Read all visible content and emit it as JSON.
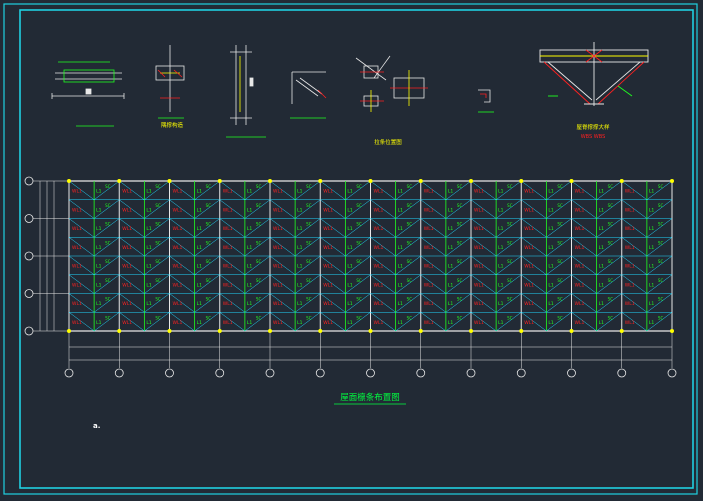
{
  "drawing": {
    "detail_captions": [
      "隅撑构造",
      "拉条位置图",
      "屋脊撑撑大样"
    ],
    "detail_sub_caption": "WBS WBS",
    "plan_title": "屋面檩条布置图",
    "note_mark": "a."
  },
  "plan_labels": {
    "purlin": "WL1",
    "tie": "L1",
    "brace": "SC"
  },
  "colors": {
    "background": "#222a35",
    "frame": "#20d0e0",
    "structure": "#e8e8e8",
    "purlin": "#ff2020",
    "tie": "#20ff20",
    "cyan_line": "#20d8ff",
    "node": "#ffff00",
    "caption": "#ffff00",
    "title": "#00ff40"
  }
}
